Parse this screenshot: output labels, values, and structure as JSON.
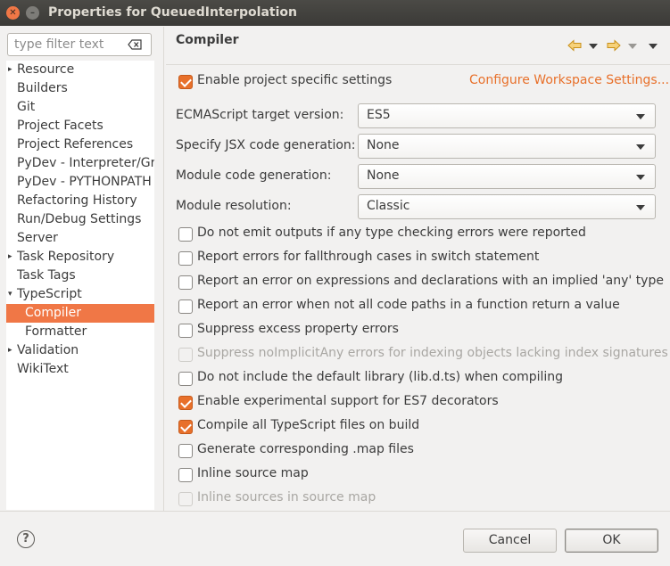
{
  "window": {
    "title": "Properties for QueuedInterpolation"
  },
  "filter": {
    "placeholder": "type filter text"
  },
  "tree": {
    "items": [
      {
        "label": "Resource",
        "arrow": "▸"
      },
      {
        "label": "Builders",
        "arrow": ""
      },
      {
        "label": "Git",
        "arrow": ""
      },
      {
        "label": "Project Facets",
        "arrow": ""
      },
      {
        "label": "Project References",
        "arrow": ""
      },
      {
        "label": "PyDev - Interpreter/Gra",
        "arrow": ""
      },
      {
        "label": "PyDev - PYTHONPATH",
        "arrow": ""
      },
      {
        "label": "Refactoring History",
        "arrow": ""
      },
      {
        "label": "Run/Debug Settings",
        "arrow": ""
      },
      {
        "label": "Server",
        "arrow": ""
      },
      {
        "label": "Task Repository",
        "arrow": "▸"
      },
      {
        "label": "Task Tags",
        "arrow": ""
      },
      {
        "label": "TypeScript",
        "arrow": "▾"
      },
      {
        "label": "Compiler",
        "arrow": ""
      },
      {
        "label": "Formatter",
        "arrow": ""
      },
      {
        "label": "Validation",
        "arrow": "▸"
      },
      {
        "label": "WikiText",
        "arrow": ""
      }
    ]
  },
  "page": {
    "title": "Compiler",
    "enable_label": "Enable project specific settings",
    "configure_link": "Configure Workspace Settings...",
    "fields": [
      {
        "label": "ECMAScript target version:",
        "value": "ES5"
      },
      {
        "label": "Specify JSX code generation:",
        "value": "None"
      },
      {
        "label": "Module code generation:",
        "value": "None"
      },
      {
        "label": "Module resolution:",
        "value": "Classic"
      }
    ],
    "options": [
      {
        "label": "Do not emit outputs if any type checking errors were reported",
        "checked": false,
        "disabled": false
      },
      {
        "label": "Report errors for fallthrough cases in switch statement",
        "checked": false,
        "disabled": false
      },
      {
        "label": "Report an error on expressions and declarations with an implied 'any' type",
        "checked": false,
        "disabled": false
      },
      {
        "label": "Report an error when not all code paths in a function return a value",
        "checked": false,
        "disabled": false
      },
      {
        "label": "Suppress excess property errors",
        "checked": false,
        "disabled": false
      },
      {
        "label": "Suppress noImplicitAny errors for indexing objects lacking index signatures",
        "checked": false,
        "disabled": true
      },
      {
        "label": "Do not include the default library (lib.d.ts) when compiling",
        "checked": false,
        "disabled": false
      },
      {
        "label": "Enable experimental support for ES7 decorators",
        "checked": true,
        "disabled": false
      },
      {
        "label": "Compile all TypeScript files on build",
        "checked": true,
        "disabled": false
      },
      {
        "label": "Generate corresponding .map files",
        "checked": false,
        "disabled": false
      },
      {
        "label": "Inline source map",
        "checked": false,
        "disabled": false
      },
      {
        "label": "Inline sources in source map",
        "checked": false,
        "disabled": true
      }
    ]
  },
  "buttons": {
    "help": "?",
    "cancel": "Cancel",
    "ok": "OK"
  },
  "colors": {
    "accent": "#e8702a",
    "selection": "#f07746"
  }
}
